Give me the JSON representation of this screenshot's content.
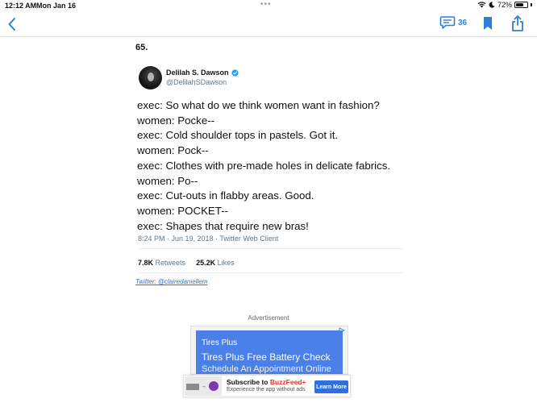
{
  "status_bar": {
    "time": "12:12 AM",
    "date": "Mon Jan 16",
    "battery": "72%",
    "battery_level": 0.72
  },
  "nav": {
    "comment_count": "36"
  },
  "article": {
    "item_number": "65."
  },
  "tweet": {
    "author_name": "Delilah S. Dawson",
    "handle": "@DelilahSDawson",
    "lines": [
      "exec: So what do we think women want in fashion?",
      "women: Pocke--",
      "exec: Cold shoulder tops in pastels. Got it.",
      "women: Pock--",
      "exec: Clothes with pre-made holes in delicate fabrics.",
      "women: Po--",
      "exec: Cut-outs in flabby areas. Good.",
      "women: POCKET--",
      "exec: Shapes that require new bras!"
    ],
    "timestamp": "8:24 PM · Jun 19, 2018 · Twitter Web Client",
    "retweets_count": "7.8K",
    "retweets_label": "Retweets",
    "likes_count": "25.2K",
    "likes_label": "Likes"
  },
  "credit": {
    "text": "Twitter: @clairedaniellem"
  },
  "advertisement": {
    "label": "Advertisement",
    "brand": "Tires Plus",
    "headline": "Tires Plus Free Battery Check",
    "subline": "Schedule An Appointment Online"
  },
  "banner": {
    "title_prefix": "Subscribe to ",
    "title_brand": "BuzzFeed+",
    "subtitle": "Experience the app without ads",
    "button_label": "Learn More"
  },
  "colors": {
    "accent_blue": "#2f7ed8",
    "ad_blue": "#4a80e8",
    "verified_blue": "#1da1f2"
  }
}
